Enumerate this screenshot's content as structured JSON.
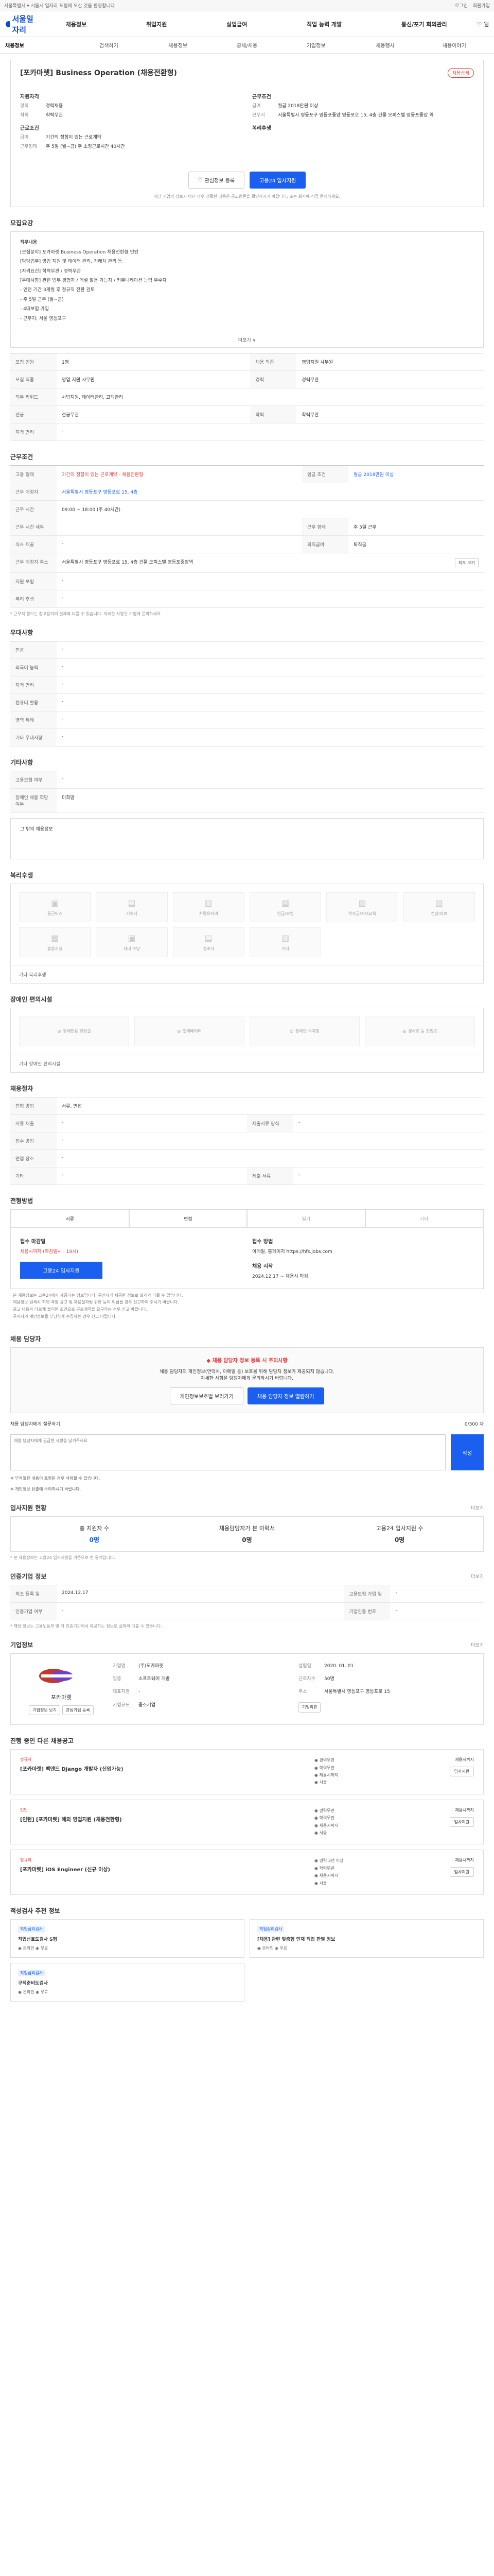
{
  "topbar": {
    "left": "서울특별시 ▾  서울시 일자리 포털에 오신 것을 환영합니다",
    "right1": "로그인",
    "right2": "회원가입"
  },
  "header": {
    "logo": "서울일자리",
    "menus": [
      "채용정보",
      "취업지원",
      "실업급여",
      "직업 능력 개발",
      "통신/포기 회의관리"
    ],
    "globe": "♡ 웹"
  },
  "subnav": {
    "active": "채용정보",
    "items": [
      "검색하기",
      "채용정보",
      "공채/채용",
      "기업정보",
      "채용행사",
      "채용이야기"
    ]
  },
  "title": {
    "name": "[포카마렛] Business Operation (채용전환형)",
    "badge": "채용상세"
  },
  "left_info": {
    "head1": "지원자격",
    "k1": "경력",
    "v1": "경력채용",
    "k2": "학력",
    "v2": "학력무관",
    "head2": "근로조건",
    "k3": "급여",
    "v3": "기간의 정함이 있는 근로계약",
    "k4": "근무형태",
    "v4": "주 5일 (월~금) 주 소정근로시간 40시간"
  },
  "right_info": {
    "head1": "근무조건",
    "k1": "급여",
    "v1": "월급 2018만원 이상",
    "k2": "근무지",
    "v2": "서울특별시 영등포구 영등포중앙 영등포로 15, 4층 건물 오피스텔 영등포중앙 역",
    "head2": "복리후생",
    "k3": "",
    "v3": ""
  },
  "buttons": {
    "interest": "관심정보 등록",
    "apply": "고용24 입사지원"
  },
  "notice": "해당 기업의 정보가 아닌 경우 정확한 내용은 공고원문을 확인하시기 바랍니다. 또는 회사에 직접 문의하세요.",
  "recruit": {
    "title": "모집요강",
    "heading": "직무내용",
    "lines": [
      "[모집분야] 포카마렛 Business Operation 채용전환형 인턴",
      "[담당업무] 영업 지원 및 데이터 관리, 거래처 관리 등",
      "[자격요건] 학력무관 / 경력무관",
      "[우대사항] 관련 업무 경험자 / 엑셀 활용 가능자 / 커뮤니케이션 능력 우수자",
      "- 인턴 기간 3개월 후 정규직 전환 검토",
      "- 주 5일 근무 (월~금)",
      "- 4대보험 가입",
      "- 근무지: 서울 영등포구"
    ],
    "more": "더보기 ∨",
    "rows": [
      {
        "k": "모집 인원",
        "v": "1명",
        "k2": "채용 직종",
        "v2": "영업지원 사무원"
      },
      {
        "k": "모집 직종",
        "v": "영업 지원 사무원",
        "k2": "경력",
        "v2": "경력무관"
      },
      {
        "k": "직무 키워드",
        "v": "사업지원, 데이터관리, 고객관리",
        "k2": "",
        "v2": ""
      },
      {
        "k": "전공",
        "v": "전공무관",
        "k2": "학력",
        "v2": "학력무관"
      },
      {
        "k": "자격 면허",
        "v": "-",
        "k2": "",
        "v2": ""
      }
    ]
  },
  "work": {
    "title": "근무조건",
    "rows": [
      {
        "k": "고용 형태",
        "v": "기간의 정함이 있는 근로계약 - 채용전환형",
        "k2": "임금 조건",
        "v2": "월급 2018만원 이상"
      },
      {
        "k": "근무 예정지",
        "v": "서울특별시 영등포구 영등포로 15, 4층",
        "k2": "",
        "v2": ""
      },
      {
        "k": "근무 시간",
        "v": "09:00 ~ 18:00 (주 40시간)",
        "k2": "",
        "v2": ""
      },
      {
        "k": "근무 시간 세부",
        "v": "",
        "k2": "근무 형태",
        "v2": "주 5일 근무"
      },
      {
        "k": "식사 제공",
        "v": "-",
        "k2": "퇴직급여",
        "v2": "퇴직금"
      },
      {
        "k": "근무 예정지 주소",
        "v": "서울특별시 영등포구 영등포로 15, 4층 건물 오피스텔 영등포중앙역",
        "k2": "",
        "v2": ""
      },
      {
        "k": "지원 보험",
        "v": "-",
        "k2": "",
        "v2": ""
      },
      {
        "k": "복리 후생",
        "v": "-",
        "k2": "",
        "v2": ""
      }
    ],
    "map_btn": "지도 보기",
    "footnote": "* 근무지 정보는 참고용이며 실제와 다를 수 있습니다. 자세한 사항은 기업에 문의하세요."
  },
  "prefer": {
    "title": "우대사항",
    "rows": [
      {
        "k": "전공",
        "v": "-"
      },
      {
        "k": "외국어 능력",
        "v": "-"
      },
      {
        "k": "자격 면허",
        "v": "-"
      },
      {
        "k": "컴퓨터 활용",
        "v": "-"
      },
      {
        "k": "병역 특례",
        "v": "-"
      },
      {
        "k": "기타 우대사항",
        "v": "-"
      }
    ]
  },
  "etc": {
    "title": "기타사항",
    "rows": [
      {
        "k": "고용보험 여부",
        "v": "-"
      },
      {
        "k": "장애인 채용 희망 여부",
        "v": "미희망"
      }
    ],
    "extra": "그 밖의 채용정보"
  },
  "welfare": {
    "title": "복리후생",
    "items": [
      "통근버스",
      "기숙사",
      "차량유지비",
      "연금/보험",
      "학자금/자녀교육",
      "건강/의료"
    ],
    "items2": [
      "휴양시설",
      "자녀 수당",
      "경조사",
      "기타"
    ],
    "etc": "기타 복리후생"
  },
  "facility": {
    "title": "장애인 편의시설",
    "items": [
      "장애인용 화장실",
      "엘리베이터",
      "장애인 주차장",
      "경사로 등 진입로"
    ],
    "etc": "기타 장애인 편의시설"
  },
  "process": {
    "title": "채용절차",
    "rows": [
      {
        "k": "전형 방법",
        "v": "서류, 면접",
        "k2": "",
        "v2": ""
      },
      {
        "k": "서류 제출",
        "v": "-",
        "k2": "제출서류 양식",
        "v2": "-"
      },
      {
        "k": "접수 방법",
        "v": "-",
        "k2": "",
        "v2": ""
      },
      {
        "k": "면접 장소",
        "v": "-",
        "k2": "",
        "v2": ""
      },
      {
        "k": "기타",
        "v": "-",
        "k2": "제출 서류",
        "v2": "-"
      }
    ]
  },
  "apply": {
    "title": "전형방법",
    "tabs": [
      "서류",
      "면접",
      "필기",
      "기타"
    ],
    "left_lbl": "접수 마감일",
    "left_val": "채용시까지 (마감일시 : 19시)",
    "right_lbl": "접수 방법",
    "right_val": "이메일, 홈페이지 https://hfs.jobs.com",
    "period_lbl": "채용 시작",
    "period_val": "2024.12.17 ~ 채용시 마감",
    "btn": "고용24 입사지원",
    "bullets": [
      "· 본 채용정보는 고용24에서 제공되는 정보입니다. 구인자가 제공한 정보로 실제와 다를 수 있습니다.",
      "· 채용정보 검색시 허위·과장 광고 및 채용절차법 위반 등이 의심될 경우 신고하여 주시기 바랍니다.",
      "· 공고 내용과 다르게 불리한 조건으로 근로계약을 요구하는 경우 신고 바랍니다.",
      "· 구직자의 개인정보를 부당하게 수집하는 경우 신고 바랍니다."
    ]
  },
  "consult": {
    "title": "채용 담당자",
    "alert": "◆ 채용 담당자 정보 등록 시 주의사항",
    "desc1": "채용 담당자의 개인정보(연락처, 이메일 등) 보호를 위해 담당자 정보가 제공되지 않습니다.",
    "desc2": "자세한 사항은 담당자에게 문의하시기 바랍니다.",
    "btn1": "개인정보보호법 보러가기",
    "btn2": "채용 담당자 정보 열람하기",
    "input_lbl": "채용 담당자에게 질문하기",
    "count": "0/300 자",
    "placeholder": "채용 담당자에게 궁금한 사항을 남겨주세요.",
    "submit": "작성",
    "checks": [
      "※ 부적절한 내용이 포함된 경우 삭제될 수 있습니다.",
      "※ 개인정보 유출에 주의하시기 바랍니다."
    ]
  },
  "stats": {
    "title": "입사지원 현황",
    "more": "더보기",
    "items": [
      {
        "k": "총 지원자 수",
        "v": "0명"
      },
      {
        "k": "채용담당자가 본 이력서",
        "v": "0명"
      },
      {
        "k": "고용24 입사지원 수",
        "v": "0명"
      }
    ],
    "note": "* 본 채용정보는 고용24 입사지원을 기준으로 한 통계입니다."
  },
  "fin": {
    "title": "인증기업 정보",
    "more": "더보기",
    "rows": [
      {
        "k": "최초 등록 일",
        "v": "2024.12.17",
        "k2": "고용보험 가입 일",
        "v2": "-"
      },
      {
        "k": "인증기업 여부",
        "v": "-",
        "k2": "기업인증 번호",
        "v2": "-"
      }
    ],
    "footnote": "* 해당 정보는 고용노동부 및 각 인증기관에서 제공하는 정보로 실제와 다를 수 있습니다."
  },
  "company": {
    "title": "기업정보",
    "more": "더보기",
    "name": "포카마렛",
    "rows": [
      {
        "k": "기업명",
        "v": "(주)포카마렛"
      },
      {
        "k": "업종",
        "v": "소프트웨어 개발"
      },
      {
        "k": "대표자명",
        "v": "-"
      },
      {
        "k": "기업규모",
        "v": "중소기업"
      },
      {
        "k": "설립일",
        "v": "2020. 01. 01"
      },
      {
        "k": "근로자수",
        "v": "50명"
      },
      {
        "k": "주소",
        "v": "서울특별시 영등포구 영등포로 15"
      }
    ],
    "btn1": "기업정보 보기",
    "btn2": "관심기업 등록",
    "btn3": "기업리뷰"
  },
  "other_jobs": {
    "title": "진행 중인 다른 채용공고",
    "items": [
      {
        "cat": "정규직",
        "title": "[포카마렛] 백엔드 Django 개발자 (신입가능)",
        "meta1": "◉ 경력무관",
        "meta2": "◉ 학력무관",
        "meta3": "◉ 채용시까지",
        "meta4": "◉ 서울",
        "deadline": "채용시까지",
        "btn": "입사지원"
      },
      {
        "cat": "인턴",
        "title": "[인턴] [포카마렛] 해외 영업지원 (채용전환형)",
        "meta1": "◉ 경력무관",
        "meta2": "◉ 학력무관",
        "meta3": "◉ 채용시까지",
        "meta4": "◉ 서울",
        "deadline": "채용시까지",
        "btn": "입사지원"
      },
      {
        "cat": "정규직",
        "title": "[포카마렛] iOS Engineer (신규 이상)",
        "meta1": "◉ 경력 3년 이상",
        "meta2": "◉ 학력무관",
        "meta3": "◉ 채용시까지",
        "meta4": "◉ 서울",
        "deadline": "채용시까지",
        "btn": "입사지원"
      }
    ]
  },
  "recommend": {
    "title": "적성검사 추천 정보",
    "items": [
      {
        "tag": "직업심리검사",
        "title": "직업선호도검사 S형",
        "meta": "◉ 온라인  ◉ 무료"
      },
      {
        "tag": "직업심리검사",
        "title": "[채용] 관련 맞춤형 인재 직업 판별 정보",
        "meta": "◉ 온라인  ◉ 무료"
      },
      {
        "tag": "직업심리검사",
        "title": "구직준비도검사",
        "meta": "◉ 온라인  ◉ 무료"
      }
    ]
  }
}
